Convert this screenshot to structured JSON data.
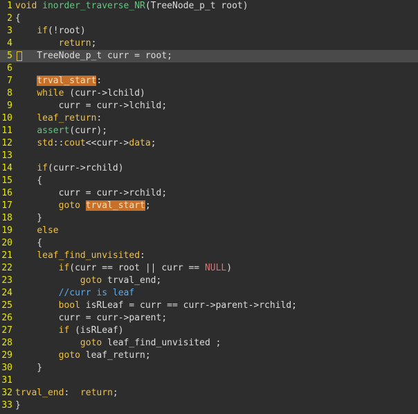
{
  "editor": {
    "lines": [
      {
        "n": "1",
        "parts": [
          {
            "t": "void ",
            "c": "kw"
          },
          {
            "t": "inorder_traverse_NR",
            "c": "fn"
          },
          {
            "t": "(TreeNode_p_t root)",
            "c": ""
          }
        ]
      },
      {
        "n": "2",
        "parts": [
          {
            "t": "{",
            "c": ""
          }
        ]
      },
      {
        "n": "3",
        "parts": [
          {
            "t": "    ",
            "c": ""
          },
          {
            "t": "if",
            "c": "kw"
          },
          {
            "t": "(!root)",
            "c": ""
          }
        ]
      },
      {
        "n": "4",
        "parts": [
          {
            "t": "        ",
            "c": ""
          },
          {
            "t": "return",
            "c": "kw"
          },
          {
            "t": ";",
            "c": ""
          }
        ]
      },
      {
        "n": "5",
        "parts": [
          {
            "t": "    TreeNode_p_t curr = root;",
            "c": ""
          }
        ],
        "current": true
      },
      {
        "n": "6",
        "parts": []
      },
      {
        "n": "7",
        "parts": [
          {
            "t": "    ",
            "c": ""
          },
          {
            "t": "trval_start",
            "c": "lbl hl"
          },
          {
            "t": ":",
            "c": ""
          }
        ]
      },
      {
        "n": "8",
        "parts": [
          {
            "t": "    ",
            "c": ""
          },
          {
            "t": "while",
            "c": "kw"
          },
          {
            "t": " (curr->lchild)",
            "c": ""
          }
        ]
      },
      {
        "n": "9",
        "parts": [
          {
            "t": "        curr = curr->lchild;",
            "c": ""
          }
        ]
      },
      {
        "n": "10",
        "parts": [
          {
            "t": "    ",
            "c": ""
          },
          {
            "t": "leaf_return",
            "c": "lbl"
          },
          {
            "t": ":",
            "c": ""
          }
        ]
      },
      {
        "n": "11",
        "parts": [
          {
            "t": "    ",
            "c": ""
          },
          {
            "t": "assert",
            "c": "fn"
          },
          {
            "t": "(curr);",
            "c": ""
          }
        ]
      },
      {
        "n": "12",
        "parts": [
          {
            "t": "    ",
            "c": ""
          },
          {
            "t": "std",
            "c": "std"
          },
          {
            "t": "::",
            "c": ""
          },
          {
            "t": "cout",
            "c": "std"
          },
          {
            "t": "<<curr->",
            "c": ""
          },
          {
            "t": "data",
            "c": "mem"
          },
          {
            "t": ";",
            "c": ""
          }
        ]
      },
      {
        "n": "13",
        "parts": []
      },
      {
        "n": "14",
        "parts": [
          {
            "t": "    ",
            "c": ""
          },
          {
            "t": "if",
            "c": "kw"
          },
          {
            "t": "(curr->rchild)",
            "c": ""
          }
        ]
      },
      {
        "n": "15",
        "parts": [
          {
            "t": "    {",
            "c": ""
          }
        ]
      },
      {
        "n": "16",
        "parts": [
          {
            "t": "        curr = curr->rchild;",
            "c": ""
          }
        ]
      },
      {
        "n": "17",
        "parts": [
          {
            "t": "        ",
            "c": ""
          },
          {
            "t": "goto",
            "c": "kw"
          },
          {
            "t": " ",
            "c": ""
          },
          {
            "t": "trval_start",
            "c": "lbl hl"
          },
          {
            "t": ";",
            "c": ""
          }
        ]
      },
      {
        "n": "18",
        "parts": [
          {
            "t": "    }",
            "c": ""
          }
        ]
      },
      {
        "n": "19",
        "parts": [
          {
            "t": "    ",
            "c": ""
          },
          {
            "t": "else",
            "c": "kw"
          }
        ]
      },
      {
        "n": "20",
        "parts": [
          {
            "t": "    {",
            "c": ""
          }
        ]
      },
      {
        "n": "21",
        "parts": [
          {
            "t": "    ",
            "c": ""
          },
          {
            "t": "leaf_find_unvisited",
            "c": "lbl"
          },
          {
            "t": ":",
            "c": ""
          }
        ]
      },
      {
        "n": "22",
        "parts": [
          {
            "t": "        ",
            "c": ""
          },
          {
            "t": "if",
            "c": "kw"
          },
          {
            "t": "(curr == root || curr == ",
            "c": ""
          },
          {
            "t": "NULL",
            "c": "null"
          },
          {
            "t": ")",
            "c": ""
          }
        ]
      },
      {
        "n": "23",
        "parts": [
          {
            "t": "            ",
            "c": ""
          },
          {
            "t": "goto",
            "c": "kw"
          },
          {
            "t": " trval_end;",
            "c": ""
          }
        ]
      },
      {
        "n": "24",
        "parts": [
          {
            "t": "        ",
            "c": ""
          },
          {
            "t": "//curr is leaf",
            "c": "cmt"
          }
        ]
      },
      {
        "n": "25",
        "parts": [
          {
            "t": "        ",
            "c": ""
          },
          {
            "t": "bool",
            "c": "kw"
          },
          {
            "t": " isRLeaf = curr == curr->parent->rchild;",
            "c": ""
          }
        ]
      },
      {
        "n": "26",
        "parts": [
          {
            "t": "        curr = curr->parent;",
            "c": ""
          }
        ]
      },
      {
        "n": "27",
        "parts": [
          {
            "t": "        ",
            "c": ""
          },
          {
            "t": "if",
            "c": "kw"
          },
          {
            "t": " (isRLeaf)",
            "c": ""
          }
        ]
      },
      {
        "n": "28",
        "parts": [
          {
            "t": "            ",
            "c": ""
          },
          {
            "t": "goto",
            "c": "kw"
          },
          {
            "t": " leaf_find_unvisited ;",
            "c": ""
          }
        ]
      },
      {
        "n": "29",
        "parts": [
          {
            "t": "        ",
            "c": ""
          },
          {
            "t": "goto",
            "c": "kw"
          },
          {
            "t": " leaf_return;",
            "c": ""
          }
        ]
      },
      {
        "n": "30",
        "parts": [
          {
            "t": "    }",
            "c": ""
          }
        ]
      },
      {
        "n": "31",
        "parts": []
      },
      {
        "n": "32",
        "parts": [
          {
            "t": "trval_end",
            "c": "lbl"
          },
          {
            "t": ":  ",
            "c": ""
          },
          {
            "t": "return",
            "c": "kw"
          },
          {
            "t": ";",
            "c": ""
          }
        ]
      },
      {
        "n": "33",
        "parts": [
          {
            "t": "}",
            "c": ""
          }
        ]
      }
    ]
  },
  "colors": {
    "background": "#2d2d2d",
    "current_line": "#4a4a4a",
    "line_number": "#e8e800",
    "keyword": "#f0c040",
    "function": "#5fc87d",
    "comment": "#5fa8e6",
    "null": "#e07070",
    "highlight": "#c87028"
  }
}
